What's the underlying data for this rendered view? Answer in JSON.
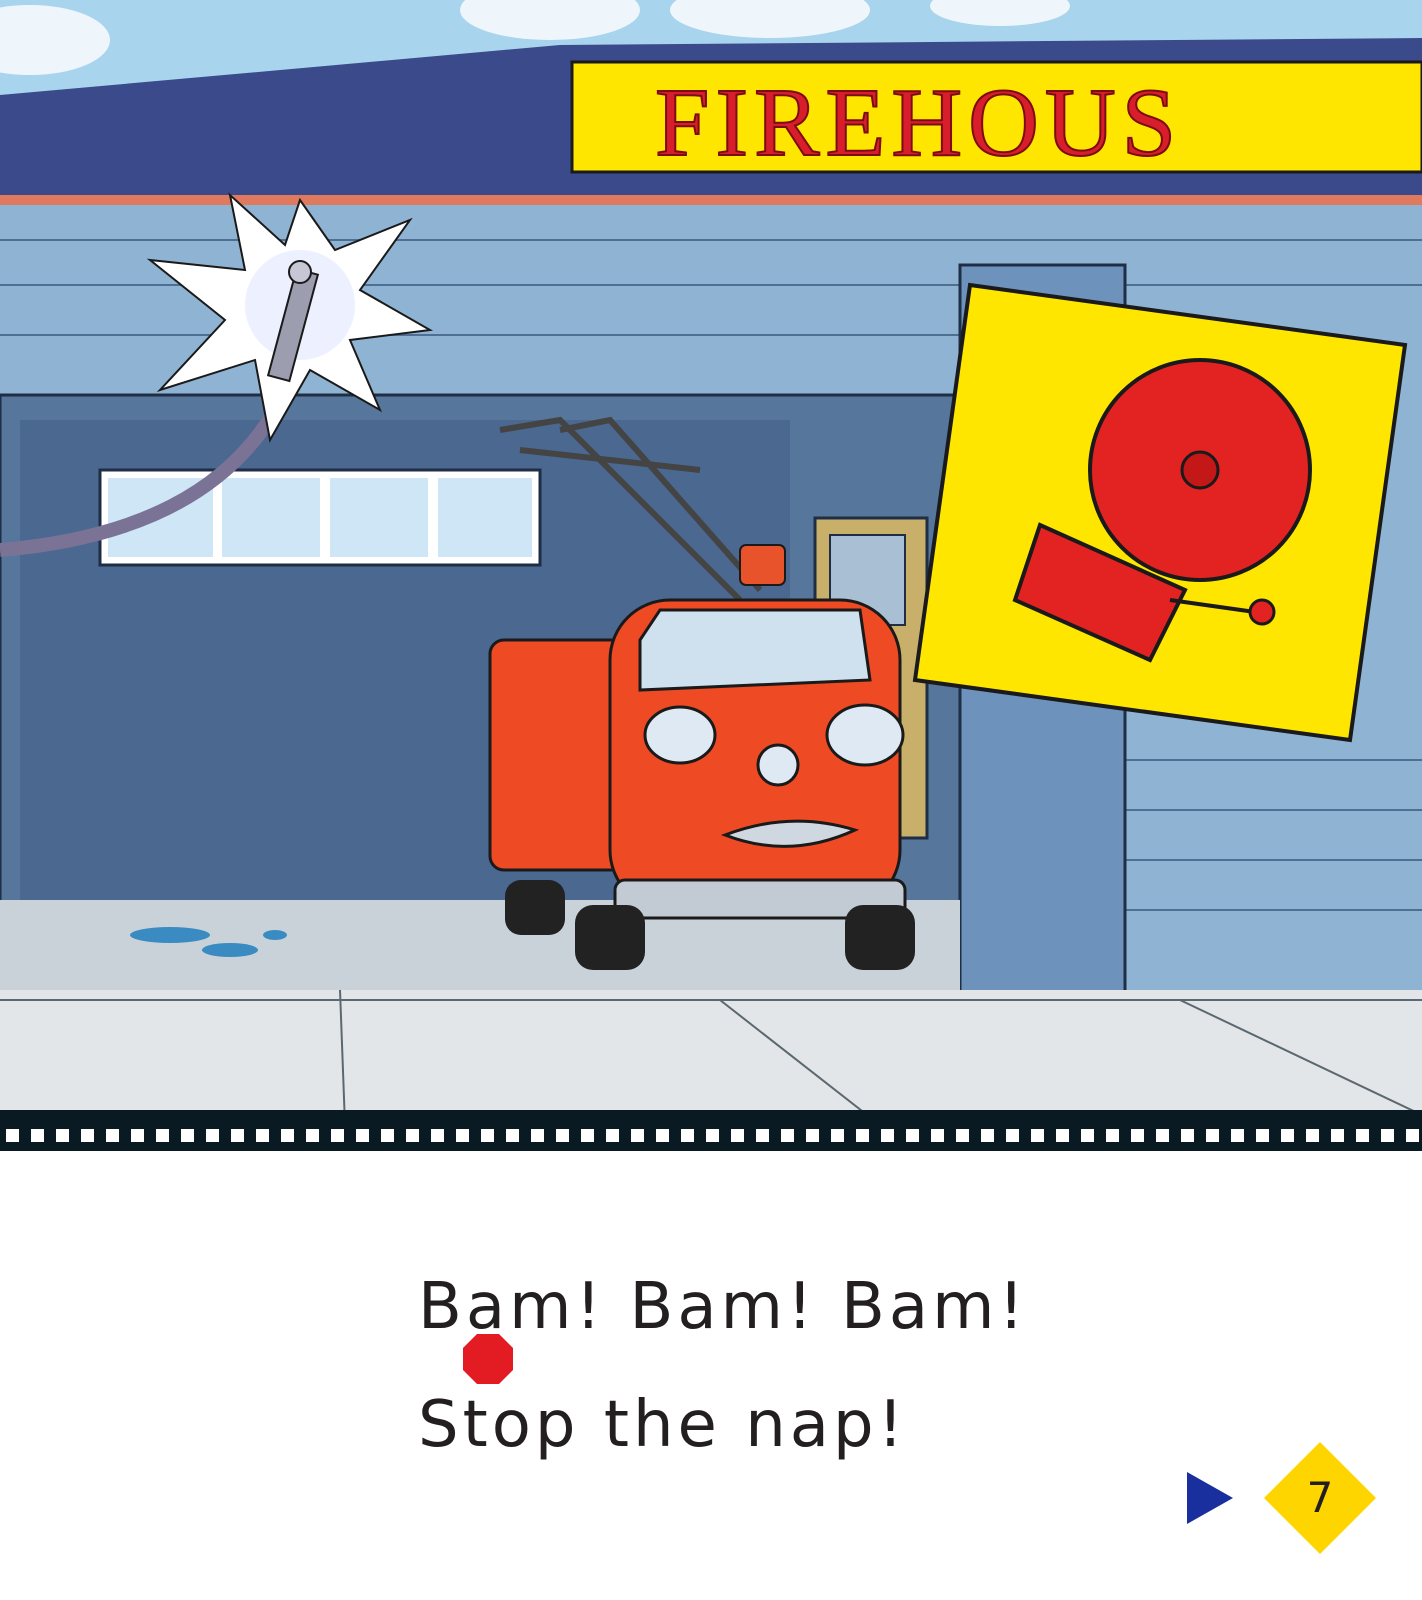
{
  "scene": {
    "sign_text": "FIREHOUS",
    "colors": {
      "sky": "#a8d4ee",
      "roof": "#3b4a8a",
      "wall": "#8fb3d3",
      "sign_bg": "#ffe600",
      "sign_text": "#d81e2a",
      "truck": "#ee4b24",
      "bell": "#e32222",
      "pavement": "#e3e6e8"
    }
  },
  "story": {
    "line1": "Bam! Bam! Bam!",
    "line2": "Stop the nap!"
  },
  "navigation": {
    "next_icon": "play-arrow-icon",
    "page_number": "7",
    "arrow_color": "#1a2f9e",
    "badge_color": "#ffd500"
  }
}
